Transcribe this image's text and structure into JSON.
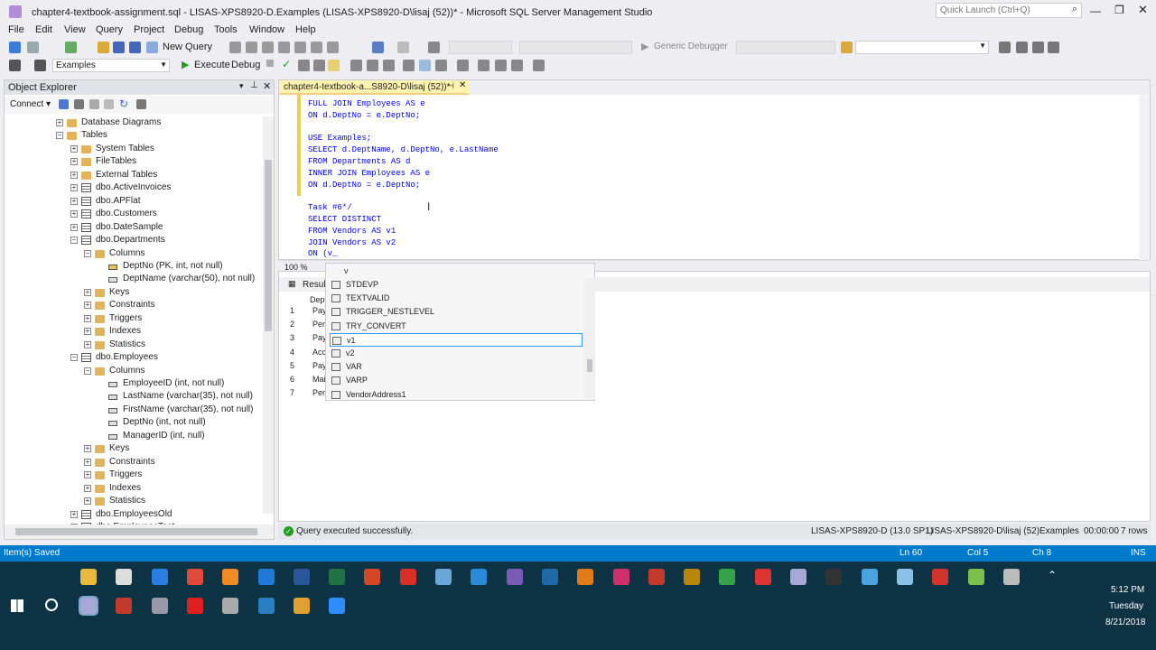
{
  "window": {
    "title": "chapter4-textbook-assignment.sql - LISAS-XPS8920-D.Examples (LISAS-XPS8920-D\\lisaj (52))* - Microsoft SQL Server Management Studio",
    "quick_launch_placeholder": "Quick Launch (Ctrl+Q)"
  },
  "menu": [
    "File",
    "Edit",
    "View",
    "Query",
    "Project",
    "Debug",
    "Tools",
    "Window",
    "Help"
  ],
  "toolbar": {
    "new_query": "New Query",
    "debugger": "Generic Debugger",
    "database": "Examples",
    "execute": "Execute",
    "debug": "Debug"
  },
  "object_explorer": {
    "title": "Object Explorer",
    "connect": "Connect ▾",
    "nodes": [
      {
        "label": "Database Diagrams",
        "level": 3,
        "expander": "+",
        "icon": "folder-icon"
      },
      {
        "label": "Tables",
        "level": 3,
        "expander": "−",
        "icon": "folder-icon"
      },
      {
        "label": "System Tables",
        "level": 4,
        "expander": "+",
        "icon": "folder-icon"
      },
      {
        "label": "FileTables",
        "level": 4,
        "expander": "+",
        "icon": "folder-icon"
      },
      {
        "label": "External Tables",
        "level": 4,
        "expander": "+",
        "icon": "folder-icon"
      },
      {
        "label": "dbo.ActiveInvoices",
        "level": 4,
        "expander": "+",
        "icon": "table-icon"
      },
      {
        "label": "dbo.APFlat",
        "level": 4,
        "expander": "+",
        "icon": "table-icon"
      },
      {
        "label": "dbo.Customers",
        "level": 4,
        "expander": "+",
        "icon": "table-icon"
      },
      {
        "label": "dbo.DateSample",
        "level": 4,
        "expander": "+",
        "icon": "table-icon"
      },
      {
        "label": "dbo.Departments",
        "level": 4,
        "expander": "−",
        "icon": "table-icon"
      },
      {
        "label": "Columns",
        "level": 5,
        "expander": "−",
        "icon": "folder-icon"
      },
      {
        "label": "DeptNo (PK, int, not null)",
        "level": 6,
        "expander": "",
        "icon": "key-icon"
      },
      {
        "label": "DeptName (varchar(50), not null)",
        "level": 6,
        "expander": "",
        "icon": "column-icon"
      },
      {
        "label": "Keys",
        "level": 5,
        "expander": "+",
        "icon": "folder-icon"
      },
      {
        "label": "Constraints",
        "level": 5,
        "expander": "+",
        "icon": "folder-icon"
      },
      {
        "label": "Triggers",
        "level": 5,
        "expander": "+",
        "icon": "folder-icon"
      },
      {
        "label": "Indexes",
        "level": 5,
        "expander": "+",
        "icon": "folder-icon"
      },
      {
        "label": "Statistics",
        "level": 5,
        "expander": "+",
        "icon": "folder-icon"
      },
      {
        "label": "dbo.Employees",
        "level": 4,
        "expander": "−",
        "icon": "table-icon"
      },
      {
        "label": "Columns",
        "level": 5,
        "expander": "−",
        "icon": "folder-icon"
      },
      {
        "label": "EmployeeID (int, not null)",
        "level": 6,
        "expander": "",
        "icon": "column-icon"
      },
      {
        "label": "LastName (varchar(35), not null)",
        "level": 6,
        "expander": "",
        "icon": "column-icon"
      },
      {
        "label": "FirstName (varchar(35), not null)",
        "level": 6,
        "expander": "",
        "icon": "column-icon"
      },
      {
        "label": "DeptNo (int, not null)",
        "level": 6,
        "expander": "",
        "icon": "column-icon"
      },
      {
        "label": "ManagerID (int, null)",
        "level": 6,
        "expander": "",
        "icon": "column-icon"
      },
      {
        "label": "Keys",
        "level": 5,
        "expander": "+",
        "icon": "folder-icon"
      },
      {
        "label": "Constraints",
        "level": 5,
        "expander": "+",
        "icon": "folder-icon"
      },
      {
        "label": "Triggers",
        "level": 5,
        "expander": "+",
        "icon": "folder-icon"
      },
      {
        "label": "Indexes",
        "level": 5,
        "expander": "+",
        "icon": "folder-icon"
      },
      {
        "label": "Statistics",
        "level": 5,
        "expander": "+",
        "icon": "folder-icon"
      },
      {
        "label": "dbo.EmployeesOld",
        "level": 4,
        "expander": "+",
        "icon": "table-icon"
      },
      {
        "label": "dbo.EmployeesTest",
        "level": 4,
        "expander": "+",
        "icon": "table-icon"
      }
    ]
  },
  "editor": {
    "tab_label": "chapter4-textbook-a...S8920-D\\lisaj (52))*",
    "zoom": "100 %",
    "lines": [
      "FULL JOIN Employees AS e",
      "ON d.DeptNo = e.DeptNo;",
      "",
      "USE Examples;",
      "SELECT d.DeptName, d.DeptNo, e.LastName",
      "FROM Departments AS d",
      "INNER JOIN Employees AS e",
      "ON d.DeptNo = e.DeptNo;",
      "",
      "Task #6*/",
      "SELECT DISTINCT",
      "FROM Vendors AS v1",
      "JOIN Vendors AS v2",
      "ON (v_"
    ]
  },
  "autocomplete": {
    "typed": "v",
    "items": [
      "STDEVP",
      "TEXTVALID",
      "TRIGGER_NESTLEVEL",
      "TRY_CONVERT",
      "v1",
      "v2",
      "VAR",
      "VARP",
      "VendorAddress1"
    ],
    "selected_index": 4
  },
  "results": {
    "tab_label": "Results",
    "header": "Dept",
    "rows": [
      {
        "num": "1",
        "val": "Payr"
      },
      {
        "num": "2",
        "val": "Pers"
      },
      {
        "num": "3",
        "val": "Payr"
      },
      {
        "num": "4",
        "val": "Acco"
      },
      {
        "num": "5",
        "val": "Payr"
      },
      {
        "num": "6",
        "val": "Main"
      },
      {
        "num": "7",
        "val": "Pers"
      }
    ]
  },
  "query_status": {
    "message": "Query executed successfully.",
    "server": "LISAS-XPS8920-D (13.0 SP1)",
    "user": "LISAS-XPS8920-D\\lisaj (52)",
    "db": "Examples",
    "time": "00:00:00",
    "rows": "7 rows"
  },
  "app_status": {
    "left": "Item(s) Saved",
    "ln": "Ln 60",
    "col": "Col 5",
    "ch": "Ch 8",
    "mode": "INS"
  },
  "clock": {
    "time": "5:12 PM",
    "day": "Tuesday",
    "date": "8/21/2018"
  },
  "colors": {
    "accent": "#007acc",
    "taskbar": "#0d3345",
    "doctab": "#fff3b0"
  }
}
